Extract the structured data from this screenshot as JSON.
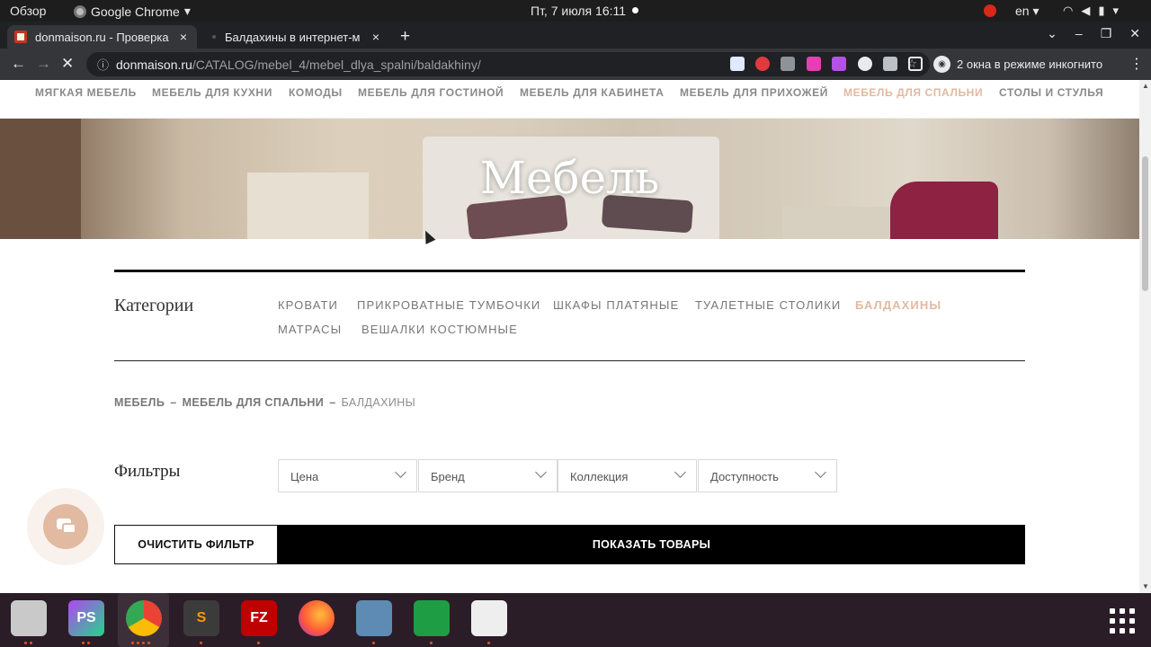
{
  "topbar": {
    "overview": "Обзор",
    "app_name": "Google Chrome",
    "clock": "Пт, 7 июля  16:11",
    "lang": "en"
  },
  "tabs": [
    {
      "title": "donmaison.ru - Проверка",
      "close": "×"
    },
    {
      "title": "Балдахины в интернет-м",
      "close": "×"
    }
  ],
  "newtab": "+",
  "toolbar": {
    "url_host": "donmaison.ru",
    "url_path": "/CATALOG/mebel_4/mebel_dlya_spalni/baldakhiny/",
    "incognito": "2 окна в режиме инкогнито"
  },
  "site_nav": [
    {
      "label": "МЯГКАЯ МЕБЕЛЬ"
    },
    {
      "label": "МЕБЕЛЬ ДЛЯ КУХНИ"
    },
    {
      "label": "КОМОДЫ"
    },
    {
      "label": "МЕБЕЛЬ ДЛЯ ГОСТИНОЙ"
    },
    {
      "label": "МЕБЕЛЬ ДЛЯ КАБИНЕТА"
    },
    {
      "label": "МЕБЕЛЬ ДЛЯ ПРИХОЖЕЙ"
    },
    {
      "label": "МЕБЕЛЬ ДЛЯ СПАЛЬНИ",
      "active": true
    },
    {
      "label": "СТОЛЫ И СТУЛЬЯ"
    }
  ],
  "hero": {
    "title": "Мебель"
  },
  "categories": {
    "title": "Категории",
    "items": [
      {
        "label": "КРОВАТИ"
      },
      {
        "label": "ПРИКРОВАТНЫЕ ТУМБОЧКИ"
      },
      {
        "label": "ШКАФЫ ПЛАТЯНЫЕ"
      },
      {
        "label": "ТУАЛЕТНЫЕ СТОЛИКИ"
      },
      {
        "label": "БАЛДАХИНЫ",
        "active": true
      },
      {
        "label": "МАТРАСЫ"
      },
      {
        "label": "ВЕШАЛКИ КОСТЮМНЫЕ"
      }
    ]
  },
  "breadcrumb": {
    "items": [
      "МЕБЕЛЬ",
      "МЕБЕЛЬ ДЛЯ СПАЛЬНИ",
      "БАЛДАХИНЫ"
    ],
    "separator": "–"
  },
  "filters": {
    "title": "Фильтры",
    "dropdowns": [
      "Цена",
      "Бренд",
      "Коллекция",
      "Доступность"
    ],
    "clear_label": "ОЧИСТИТЬ ФИЛЬТР",
    "show_label": "ПОКАЗАТЬ ТОВАРЫ"
  },
  "dock": {
    "apps": [
      {
        "name": "files",
        "icon": "folder-icon"
      },
      {
        "name": "phpstorm",
        "label": "PS"
      },
      {
        "name": "chrome",
        "icon": "chrome-icon"
      },
      {
        "name": "sublime",
        "label": "S"
      },
      {
        "name": "filezilla",
        "label": "FZ"
      },
      {
        "name": "firefox",
        "icon": "firefox-icon"
      },
      {
        "name": "video",
        "icon": "video-icon"
      },
      {
        "name": "spreadsheet",
        "icon": "spreadsheet-icon"
      },
      {
        "name": "viewer",
        "icon": "document-viewer-icon"
      }
    ]
  },
  "colors": {
    "accent": "#e2b9a1",
    "chrome_dark": "#202124",
    "chrome_toolbar": "#35363a",
    "dock": "#2b1d27"
  }
}
